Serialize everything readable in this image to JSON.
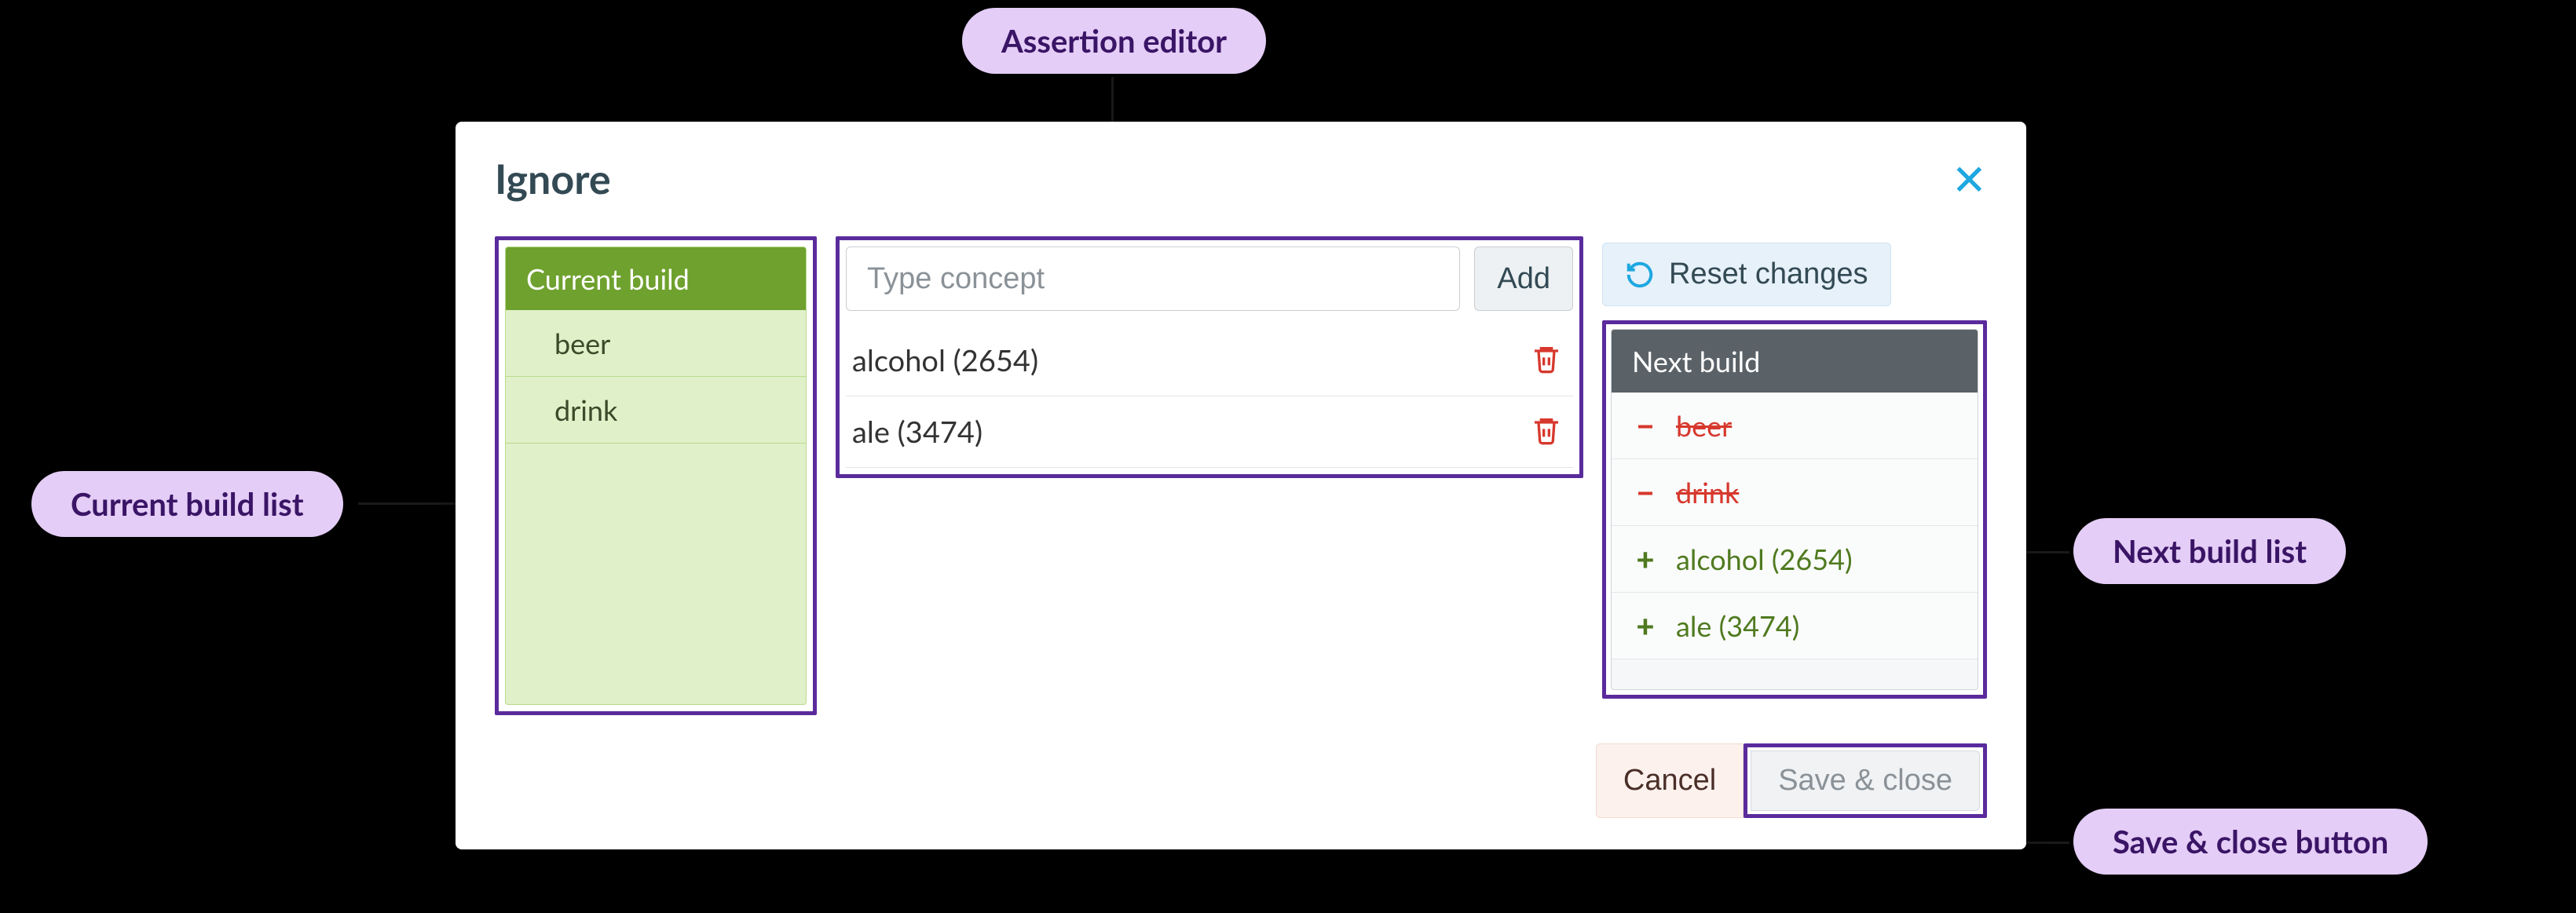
{
  "annotations": {
    "assertion_editor": "Assertion editor",
    "current_build_list": "Current build list",
    "next_build_list": "Next build list",
    "save_close_button": "Save & close button"
  },
  "modal": {
    "title": "Ignore",
    "close_icon": "close"
  },
  "current_build": {
    "header": "Current build",
    "items": [
      "beer",
      "drink"
    ]
  },
  "editor": {
    "input_placeholder": "Type concept",
    "add_label": "Add",
    "items": [
      {
        "label": "alcohol (2654)"
      },
      {
        "label": "ale (3474)"
      }
    ]
  },
  "reset": {
    "label": "Reset changes"
  },
  "next_build": {
    "header": "Next build",
    "items": [
      {
        "diff": "removed",
        "label": "beer"
      },
      {
        "diff": "removed",
        "label": "drink"
      },
      {
        "diff": "added",
        "label": "alcohol (2654)"
      },
      {
        "diff": "added",
        "label": "ale (3474)"
      }
    ]
  },
  "footer": {
    "cancel": "Cancel",
    "save": "Save & close"
  },
  "colors": {
    "annotation_bg": "#e4cdf6",
    "annotation_text": "#3a1566",
    "highlight_border": "#5a2b9c",
    "green_header": "#6fa12e",
    "green_panel": "#e0f0c8",
    "next_header": "#5a6268",
    "removed": "#d7382d",
    "added": "#4f7a1f",
    "close": "#1ea7e0"
  }
}
